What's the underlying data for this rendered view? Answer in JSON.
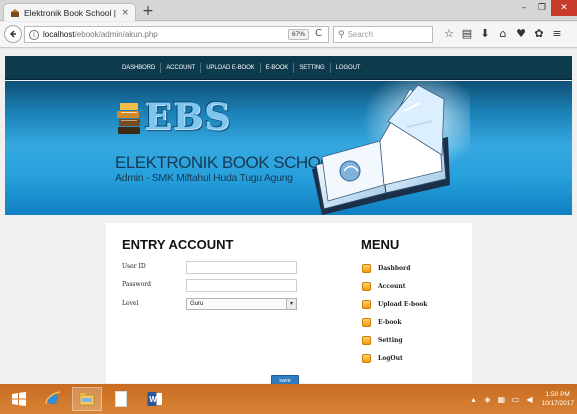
{
  "browser": {
    "tab_title": "Elektronik Book School | e-b",
    "tab_close": "×",
    "new_tab": "+",
    "window_minimize": "–",
    "window_maximize": "❐",
    "window_close": "✕",
    "url_host": "localhost",
    "url_path": "/ebook/admin/akun.php",
    "zoom": "67%",
    "reload": "C",
    "search_placeholder": "Search"
  },
  "site": {
    "nav": [
      "DASHBORD",
      "ACCOUNT",
      "UPLOAD E-BOOK",
      "E-BOOK",
      "SETTING",
      "LOGOUT"
    ],
    "logo_text": "EBS",
    "brand_title": "ELEKTRONIK BOOK SCHOOL",
    "brand_subtitle": "Admin - SMK Miftahul Huda Tugu Agung"
  },
  "entry": {
    "title": "ENTRY ACCOUNT",
    "user_id_label": "User ID",
    "user_id_value": "",
    "password_label": "Password",
    "password_value": "",
    "level_label": "Level",
    "level_value": "Guru",
    "level_arrow": "▾",
    "save_label": "save"
  },
  "menu": {
    "title": "MENU",
    "items": [
      "Dashbord",
      "Account",
      "Upload E-book",
      "E-book",
      "Setting",
      "LogOut"
    ]
  },
  "taskbar": {
    "time": "1:50 PM",
    "date": "10/17/2017"
  },
  "colors": {
    "site_nav": "#0d3a4c",
    "banner": "#36a8e0",
    "taskbar": "#d27628",
    "save_button": "#2f7cc0",
    "menu_bullet": "#f39a12"
  }
}
